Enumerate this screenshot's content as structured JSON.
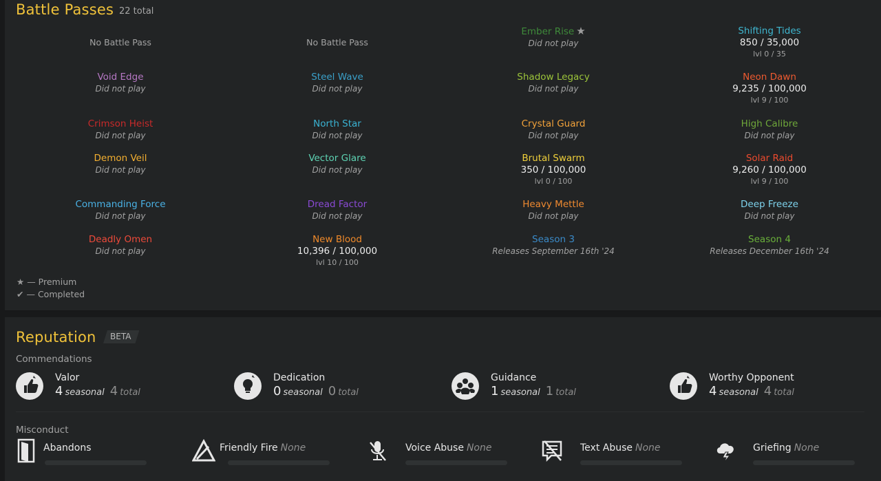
{
  "battle_passes": {
    "title": "Battle Passes",
    "count": "22 total",
    "passes": [
      {
        "name": "",
        "status": "",
        "xp": "",
        "level": "",
        "empty": "No Battle Pass",
        "color": "#a3a3a3"
      },
      {
        "name": "",
        "status": "",
        "xp": "",
        "level": "",
        "empty": "No Battle Pass",
        "color": "#a3a3a3"
      },
      {
        "name": "Ember Rise",
        "premium": true,
        "status": "Did not play",
        "color": "#3f8a3a"
      },
      {
        "name": "Shifting Tides",
        "xp": "850 / 35,000",
        "level": "lvl 0 / 35",
        "color": "#3fb6cf"
      },
      {
        "name": "Void Edge",
        "status": "Did not play",
        "color": "#b678c4"
      },
      {
        "name": "Steel Wave",
        "status": "Did not play",
        "color": "#3aa0c9"
      },
      {
        "name": "Shadow Legacy",
        "status": "Did not play",
        "color": "#9cc43a"
      },
      {
        "name": "Neon Dawn",
        "xp": "9,235 / 100,000",
        "level": "lvl 9 / 100",
        "color": "#ee5a30"
      },
      {
        "name": "Crimson Heist",
        "status": "Did not play",
        "color": "#c82a2a"
      },
      {
        "name": "North Star",
        "status": "Did not play",
        "color": "#3ab3d3"
      },
      {
        "name": "Crystal Guard",
        "status": "Did not play",
        "color": "#f2a23a"
      },
      {
        "name": "High Calibre",
        "status": "Did not play",
        "color": "#6fa83a"
      },
      {
        "name": "Demon Veil",
        "status": "Did not play",
        "color": "#f5b030"
      },
      {
        "name": "Vector Glare",
        "status": "Did not play",
        "color": "#5ed4b4"
      },
      {
        "name": "Brutal Swarm",
        "xp": "350 / 100,000",
        "level": "lvl 0 / 100",
        "color": "#f0d03a"
      },
      {
        "name": "Solar Raid",
        "xp": "9,260 / 100,000",
        "level": "lvl 9 / 100",
        "color": "#ec4a2e"
      },
      {
        "name": "Commanding Force",
        "status": "Did not play",
        "color": "#4ab2e6"
      },
      {
        "name": "Dread Factor",
        "status": "Did not play",
        "color": "#8a4ad4"
      },
      {
        "name": "Heavy Mettle",
        "status": "Did not play",
        "color": "#f08a30"
      },
      {
        "name": "Deep Freeze",
        "status": "Did not play",
        "color": "#7ed2ec"
      },
      {
        "name": "Deadly Omen",
        "status": "Did not play",
        "color": "#ee4a3a"
      },
      {
        "name": "New Blood",
        "xp": "10,396 / 100,000",
        "level": "lvl 10 / 100",
        "color": "#f08a2a"
      },
      {
        "name": "Season 3",
        "status": "Releases September 16th '24",
        "color": "#3a8ac8"
      },
      {
        "name": "Season 4",
        "status": "Releases December 16th '24",
        "color": "#6ab03a"
      }
    ],
    "legend": {
      "premium": "— Premium",
      "completed": "— Completed",
      "premium_symbol": "★",
      "completed_symbol": "✔"
    }
  },
  "reputation": {
    "title": "Reputation",
    "beta": "BETA",
    "commendations_label": "Commendations",
    "commendations": [
      {
        "label": "Valor",
        "seasonal": "4",
        "seasonal_label": "seasonal",
        "total": "4",
        "total_label": "total",
        "icon": "thumbs-up-icon"
      },
      {
        "label": "Dedication",
        "seasonal": "0",
        "seasonal_label": "seasonal",
        "total": "0",
        "total_label": "total",
        "icon": "lightbulb-icon"
      },
      {
        "label": "Guidance",
        "seasonal": "1",
        "seasonal_label": "seasonal",
        "total": "1",
        "total_label": "total",
        "icon": "group-icon"
      },
      {
        "label": "Worthy Opponent",
        "seasonal": "4",
        "seasonal_label": "seasonal",
        "total": "4",
        "total_label": "total",
        "icon": "thumbs-up-icon"
      }
    ],
    "misconduct_label": "Misconduct",
    "misconduct": [
      {
        "label": "Abandons",
        "value": "",
        "icon": "door-icon"
      },
      {
        "label": "Friendly Fire",
        "value": "None",
        "icon": "triangle-icon"
      },
      {
        "label": "Voice Abuse",
        "value": "None",
        "icon": "muted-mic-icon"
      },
      {
        "label": "Text Abuse",
        "value": "None",
        "icon": "no-text-icon"
      },
      {
        "label": "Griefing",
        "value": "None",
        "icon": "storm-cloud-icon"
      }
    ]
  }
}
